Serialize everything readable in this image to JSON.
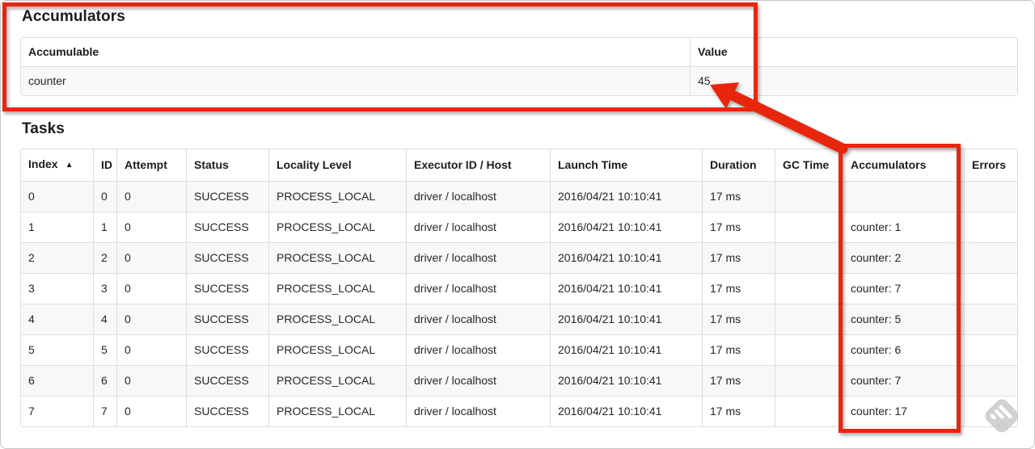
{
  "accumulators_section": {
    "heading": "Accumulators",
    "columns": {
      "accumulable": "Accumulable",
      "value": "Value"
    },
    "rows": [
      {
        "accumulable": "counter",
        "value": "45"
      }
    ]
  },
  "tasks_section": {
    "heading": "Tasks",
    "sort_indicator": "▲",
    "columns": {
      "index": "Index",
      "id": "ID",
      "attempt": "Attempt",
      "status": "Status",
      "locality": "Locality Level",
      "executor": "Executor ID / Host",
      "launch": "Launch Time",
      "duration": "Duration",
      "gc": "GC Time",
      "accumulators": "Accumulators",
      "errors": "Errors"
    },
    "rows": [
      {
        "index": "0",
        "id": "0",
        "attempt": "0",
        "status": "SUCCESS",
        "locality": "PROCESS_LOCAL",
        "executor": "driver / localhost",
        "launch": "2016/04/21 10:10:41",
        "duration": "17 ms",
        "gc": "",
        "accumulators": "",
        "errors": ""
      },
      {
        "index": "1",
        "id": "1",
        "attempt": "0",
        "status": "SUCCESS",
        "locality": "PROCESS_LOCAL",
        "executor": "driver / localhost",
        "launch": "2016/04/21 10:10:41",
        "duration": "17 ms",
        "gc": "",
        "accumulators": "counter: 1",
        "errors": ""
      },
      {
        "index": "2",
        "id": "2",
        "attempt": "0",
        "status": "SUCCESS",
        "locality": "PROCESS_LOCAL",
        "executor": "driver / localhost",
        "launch": "2016/04/21 10:10:41",
        "duration": "17 ms",
        "gc": "",
        "accumulators": "counter: 2",
        "errors": ""
      },
      {
        "index": "3",
        "id": "3",
        "attempt": "0",
        "status": "SUCCESS",
        "locality": "PROCESS_LOCAL",
        "executor": "driver / localhost",
        "launch": "2016/04/21 10:10:41",
        "duration": "17 ms",
        "gc": "",
        "accumulators": "counter: 7",
        "errors": ""
      },
      {
        "index": "4",
        "id": "4",
        "attempt": "0",
        "status": "SUCCESS",
        "locality": "PROCESS_LOCAL",
        "executor": "driver / localhost",
        "launch": "2016/04/21 10:10:41",
        "duration": "17 ms",
        "gc": "",
        "accumulators": "counter: 5",
        "errors": ""
      },
      {
        "index": "5",
        "id": "5",
        "attempt": "0",
        "status": "SUCCESS",
        "locality": "PROCESS_LOCAL",
        "executor": "driver / localhost",
        "launch": "2016/04/21 10:10:41",
        "duration": "17 ms",
        "gc": "",
        "accumulators": "counter: 6",
        "errors": ""
      },
      {
        "index": "6",
        "id": "6",
        "attempt": "0",
        "status": "SUCCESS",
        "locality": "PROCESS_LOCAL",
        "executor": "driver / localhost",
        "launch": "2016/04/21 10:10:41",
        "duration": "17 ms",
        "gc": "",
        "accumulators": "counter: 7",
        "errors": ""
      },
      {
        "index": "7",
        "id": "7",
        "attempt": "0",
        "status": "SUCCESS",
        "locality": "PROCESS_LOCAL",
        "executor": "driver / localhost",
        "launch": "2016/04/21 10:10:41",
        "duration": "17 ms",
        "gc": "",
        "accumulators": "counter: 17",
        "errors": ""
      }
    ]
  },
  "annotations": {
    "highlight_color": "#e8250e",
    "watermark_icon": "feedly-icon",
    "watermark_color": "#c9c9c9"
  }
}
